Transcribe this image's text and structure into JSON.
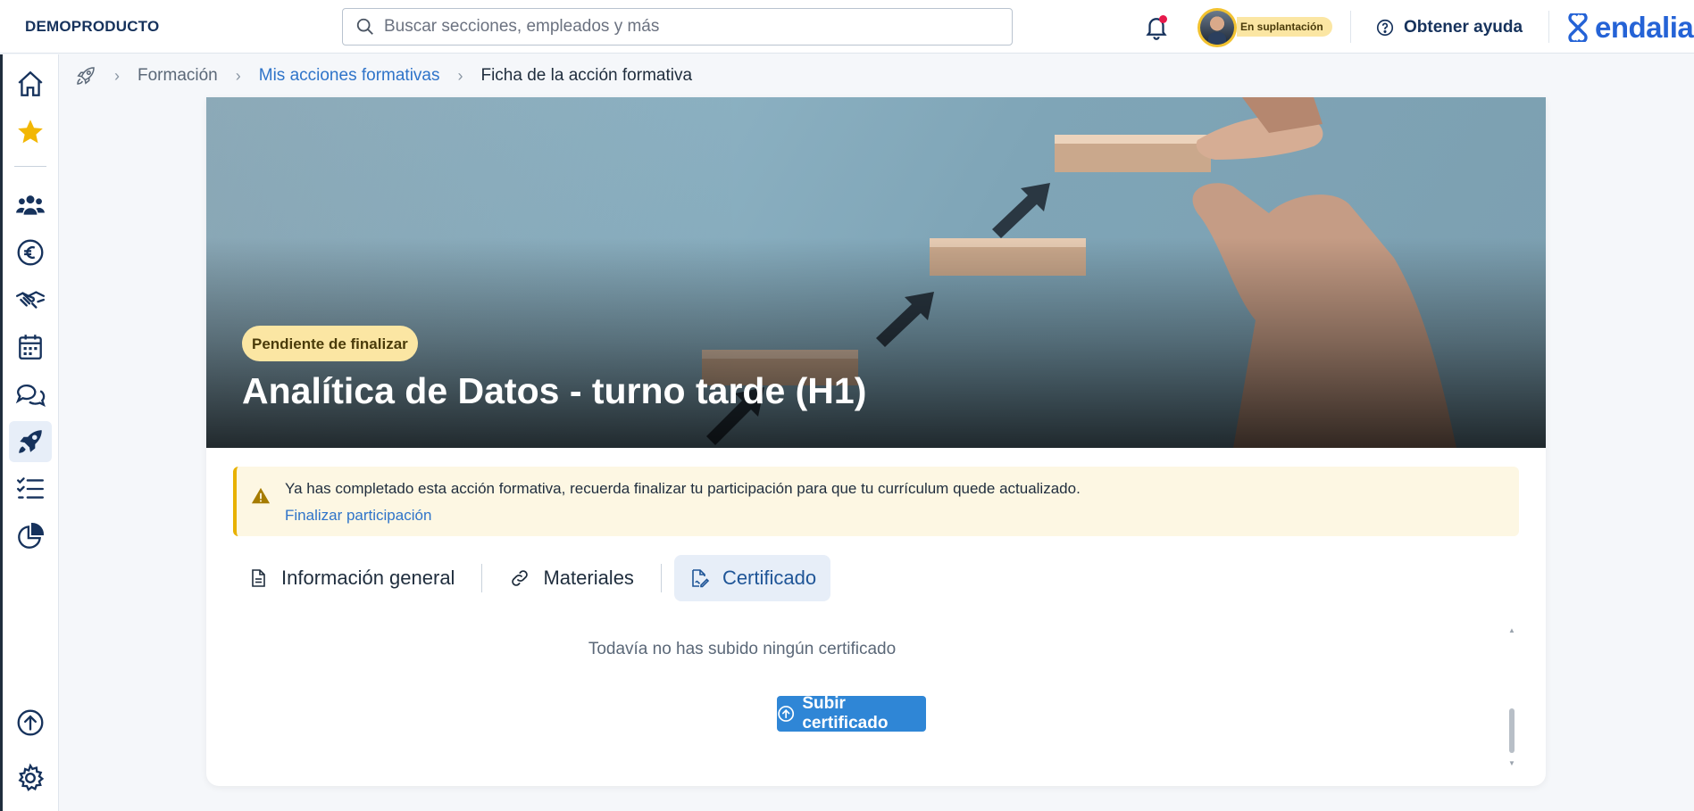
{
  "topbar": {
    "company": "DEMOPRODUCTO",
    "search_placeholder": "Buscar secciones, empleados y más",
    "impersonation_label": "En suplantación",
    "help_label": "Obtener ayuda",
    "logo_text": "endalia"
  },
  "sidebar": {
    "items": [
      {
        "icon": "home-icon"
      },
      {
        "icon": "star-icon"
      },
      {
        "icon": "people-icon"
      },
      {
        "icon": "euro-icon"
      },
      {
        "icon": "handshake-icon"
      },
      {
        "icon": "calendar-icon"
      },
      {
        "icon": "chat-icon"
      },
      {
        "icon": "rocket-icon",
        "active": true
      },
      {
        "icon": "checklist-icon"
      },
      {
        "icon": "pie-chart-icon"
      },
      {
        "icon": "upload-circle-icon"
      },
      {
        "icon": "gear-icon"
      }
    ]
  },
  "breadcrumb": {
    "items": [
      "Formación",
      "Mis acciones formativas",
      "Ficha de la acción formativa"
    ]
  },
  "course": {
    "status": "Pendiente de finalizar",
    "title": "Analítica de Datos - turno tarde (H1)"
  },
  "alert": {
    "message": "Ya has completado esta acción formativa, recuerda finalizar tu participación para que tu currículum quede actualizado.",
    "link": "Finalizar participación"
  },
  "tabs": [
    {
      "label": "Información general",
      "icon": "document-icon"
    },
    {
      "label": "Materiales",
      "icon": "link-icon"
    },
    {
      "label": "Certificado",
      "icon": "certificate-icon",
      "active": true
    }
  ],
  "certificate": {
    "empty_message": "Todavía no has subido ningún certificado",
    "upload_label": "Subir certificado"
  },
  "colors": {
    "primary": "#2f86d6",
    "link": "#2f74c9",
    "navy": "#16325c",
    "badge": "#fbe6a3",
    "warning": "#e8b100",
    "notification": "#e6194b"
  }
}
